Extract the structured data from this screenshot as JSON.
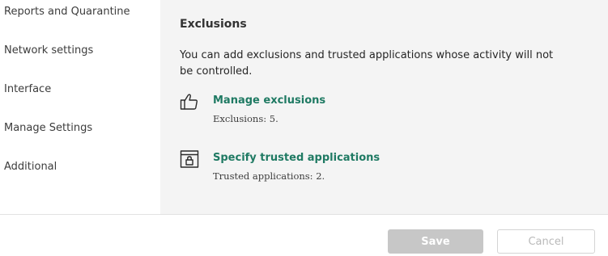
{
  "sidebar": {
    "items": [
      {
        "label": "Reports and Quarantine"
      },
      {
        "label": "Network settings"
      },
      {
        "label": "Interface"
      },
      {
        "label": "Manage Settings"
      },
      {
        "label": "Additional"
      }
    ]
  },
  "main": {
    "title": "Exclusions",
    "description": "You can add exclusions and trusted applications whose activity will not be controlled.",
    "entries": [
      {
        "icon": "thumbs-up-icon",
        "link": "Manage exclusions",
        "sub": "Exclusions: 5."
      },
      {
        "icon": "locked-window-icon",
        "link": "Specify trusted applications",
        "sub": "Trusted applications: 2."
      }
    ]
  },
  "footer": {
    "save_label": "Save",
    "cancel_label": "Cancel"
  },
  "colors": {
    "link": "#1f7a63",
    "panel_bg": "#f4f4f4",
    "disabled_button": "#c7c7c7"
  }
}
